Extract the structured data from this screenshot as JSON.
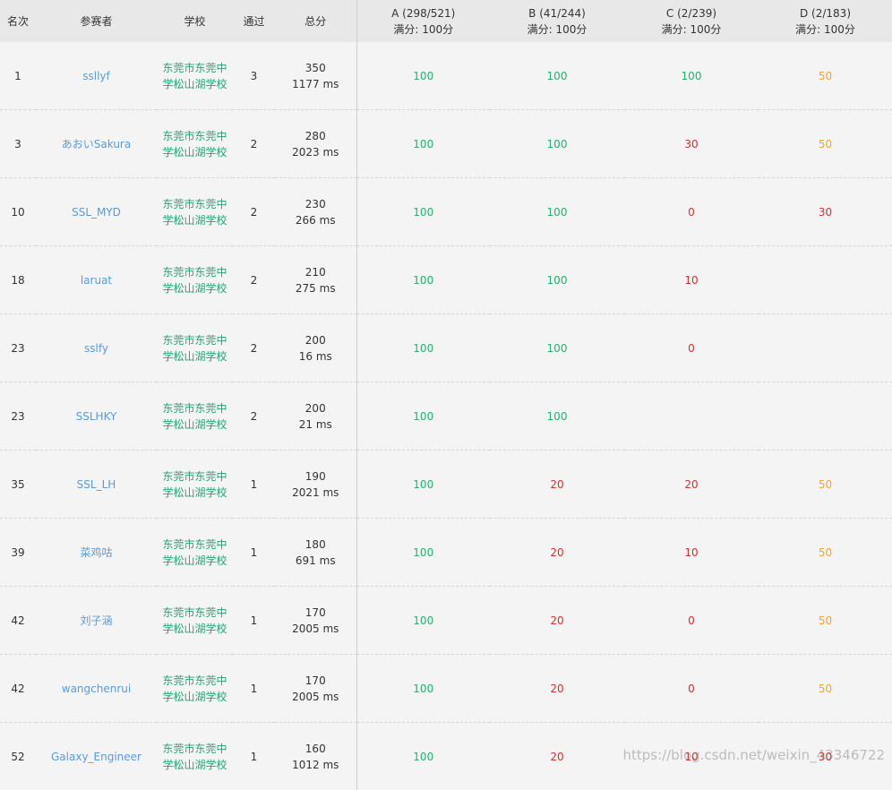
{
  "columns": {
    "rank": "名次",
    "user": "参赛者",
    "school": "学校",
    "passed": "通过",
    "total": "总分",
    "problems": [
      {
        "title": "A (298/521)",
        "full": "满分: 100分"
      },
      {
        "title": "B (41/244)",
        "full": "满分: 100分"
      },
      {
        "title": "C (2/239)",
        "full": "满分: 100分"
      },
      {
        "title": "D (2/183)",
        "full": "满分: 100分"
      }
    ]
  },
  "colors": {
    "full": "#25b06e",
    "zero_or_low": "#d0312d",
    "partial": "#f5a623",
    "link": "#5b9bd5",
    "school": "#21a675"
  },
  "rows": [
    {
      "rank": "1",
      "user": "ssllyf",
      "school1": "东莞市东莞中",
      "school2": "学松山湖学校",
      "passed": "3",
      "score": "350",
      "time": "1177 ms",
      "scores": [
        {
          "v": "100",
          "c": "s-green"
        },
        {
          "v": "100",
          "c": "s-green"
        },
        {
          "v": "100",
          "c": "s-green"
        },
        {
          "v": "50",
          "c": "s-orange"
        }
      ]
    },
    {
      "rank": "3",
      "user": "あおいSakura",
      "school1": "东莞市东莞中",
      "school2": "学松山湖学校",
      "passed": "2",
      "score": "280",
      "time": "2023 ms",
      "scores": [
        {
          "v": "100",
          "c": "s-green"
        },
        {
          "v": "100",
          "c": "s-green"
        },
        {
          "v": "30",
          "c": "s-red"
        },
        {
          "v": "50",
          "c": "s-orange"
        }
      ]
    },
    {
      "rank": "10",
      "user": "SSL_MYD",
      "school1": "东莞市东莞中",
      "school2": "学松山湖学校",
      "passed": "2",
      "score": "230",
      "time": "266 ms",
      "scores": [
        {
          "v": "100",
          "c": "s-green"
        },
        {
          "v": "100",
          "c": "s-green"
        },
        {
          "v": "0",
          "c": "s-red"
        },
        {
          "v": "30",
          "c": "s-red"
        }
      ]
    },
    {
      "rank": "18",
      "user": "laruat",
      "school1": "东莞市东莞中",
      "school2": "学松山湖学校",
      "passed": "2",
      "score": "210",
      "time": "275 ms",
      "scores": [
        {
          "v": "100",
          "c": "s-green"
        },
        {
          "v": "100",
          "c": "s-green"
        },
        {
          "v": "10",
          "c": "s-red"
        },
        {
          "v": "",
          "c": ""
        }
      ]
    },
    {
      "rank": "23",
      "user": "sslfy",
      "school1": "东莞市东莞中",
      "school2": "学松山湖学校",
      "passed": "2",
      "score": "200",
      "time": "16 ms",
      "scores": [
        {
          "v": "100",
          "c": "s-green"
        },
        {
          "v": "100",
          "c": "s-green"
        },
        {
          "v": "0",
          "c": "s-red"
        },
        {
          "v": "",
          "c": ""
        }
      ]
    },
    {
      "rank": "23",
      "user": "SSLHKY",
      "school1": "东莞市东莞中",
      "school2": "学松山湖学校",
      "passed": "2",
      "score": "200",
      "time": "21 ms",
      "scores": [
        {
          "v": "100",
          "c": "s-green"
        },
        {
          "v": "100",
          "c": "s-green"
        },
        {
          "v": "",
          "c": ""
        },
        {
          "v": "",
          "c": ""
        }
      ]
    },
    {
      "rank": "35",
      "user": "SSL_LH",
      "school1": "东莞市东莞中",
      "school2": "学松山湖学校",
      "passed": "1",
      "score": "190",
      "time": "2021 ms",
      "scores": [
        {
          "v": "100",
          "c": "s-green"
        },
        {
          "v": "20",
          "c": "s-red"
        },
        {
          "v": "20",
          "c": "s-red"
        },
        {
          "v": "50",
          "c": "s-orange"
        }
      ]
    },
    {
      "rank": "39",
      "user": "菜鸡咕",
      "school1": "东莞市东莞中",
      "school2": "学松山湖学校",
      "passed": "1",
      "score": "180",
      "time": "691 ms",
      "scores": [
        {
          "v": "100",
          "c": "s-green"
        },
        {
          "v": "20",
          "c": "s-red"
        },
        {
          "v": "10",
          "c": "s-red"
        },
        {
          "v": "50",
          "c": "s-orange"
        }
      ]
    },
    {
      "rank": "42",
      "user": "刘子涵",
      "school1": "东莞市东莞中",
      "school2": "学松山湖学校",
      "passed": "1",
      "score": "170",
      "time": "2005 ms",
      "scores": [
        {
          "v": "100",
          "c": "s-green"
        },
        {
          "v": "20",
          "c": "s-red"
        },
        {
          "v": "0",
          "c": "s-red"
        },
        {
          "v": "50",
          "c": "s-orange"
        }
      ]
    },
    {
      "rank": "42",
      "user": "wangchenrui",
      "school1": "东莞市东莞中",
      "school2": "学松山湖学校",
      "passed": "1",
      "score": "170",
      "time": "2005 ms",
      "scores": [
        {
          "v": "100",
          "c": "s-green"
        },
        {
          "v": "20",
          "c": "s-red"
        },
        {
          "v": "0",
          "c": "s-red"
        },
        {
          "v": "50",
          "c": "s-orange"
        }
      ]
    },
    {
      "rank": "52",
      "user": "Galaxy_Engineer",
      "school1": "东莞市东莞中",
      "school2": "学松山湖学校",
      "passed": "1",
      "score": "160",
      "time": "1012 ms",
      "scores": [
        {
          "v": "100",
          "c": "s-green"
        },
        {
          "v": "20",
          "c": "s-red"
        },
        {
          "v": "10",
          "c": "s-red"
        },
        {
          "v": "30",
          "c": "s-red"
        }
      ]
    }
  ],
  "watermark": "https://blog.csdn.net/weixin_43346722"
}
